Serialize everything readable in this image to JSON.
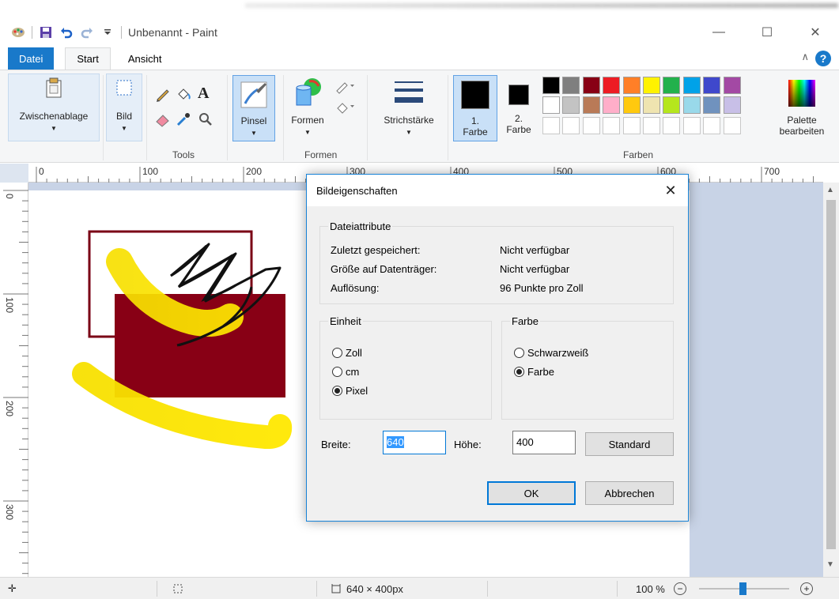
{
  "titlebar": {
    "title": "Unbenannt - Paint",
    "minimize": "—",
    "maximize": "☐",
    "close": "✕"
  },
  "tabs": [
    "Datei",
    "Start",
    "Ansicht"
  ],
  "ribbon": {
    "clipboard": "Zwischenablage",
    "image": "Bild",
    "tools_label": "Tools",
    "brush": "Pinsel",
    "shapes": "Formen",
    "shapes_group": "Formen",
    "stroke": "Strichstärke",
    "color1_num": "1.",
    "color1_label": "Farbe",
    "color2_num": "2.",
    "color2_label": "Farbe",
    "colors_group": "Farben",
    "palette_line1": "Palette",
    "palette_line2": "bearbeiten",
    "palette_colors": [
      "#000000",
      "#7f7f7f",
      "#880015",
      "#ed1c24",
      "#ff7f27",
      "#fff200",
      "#22b14c",
      "#00a2e8",
      "#3f48cc",
      "#a349a4",
      "#ffffff",
      "#c3c3c3",
      "#b97a57",
      "#ffaec9",
      "#ffc90e",
      "#efe4b0",
      "#b5e61d",
      "#99d9ea",
      "#7092be",
      "#c8bfe7"
    ]
  },
  "ruler": {
    "top_labels": [
      "0",
      "100",
      "200",
      "300",
      "400",
      "500",
      "600",
      "700"
    ],
    "left_labels": [
      "0",
      "100",
      "200",
      "300"
    ]
  },
  "dialog": {
    "title": "Bildeigenschaften",
    "close": "✕",
    "file_attrs_legend": "Dateiattribute",
    "last_saved_label": "Zuletzt gespeichert:",
    "last_saved_value": "Nicht verfügbar",
    "disk_size_label": "Größe auf Datenträger:",
    "disk_size_value": "Nicht verfügbar",
    "resolution_label": "Auflösung:",
    "resolution_value": "96 Punkte pro Zoll",
    "unit_legend": "Einheit",
    "unit_inch": "Zoll",
    "unit_cm": "cm",
    "unit_pixel": "Pixel",
    "color_legend": "Farbe",
    "color_bw": "Schwarzweiß",
    "color_color": "Farbe",
    "width_label": "Breite:",
    "width_value": "640",
    "height_label": "Höhe:",
    "height_value": "400",
    "default_btn": "Standard",
    "ok_btn": "OK",
    "cancel_btn": "Abbrechen"
  },
  "status": {
    "size": "640 × 400px",
    "zoom": "100 %",
    "zoom_out": "−",
    "zoom_in": "+"
  }
}
